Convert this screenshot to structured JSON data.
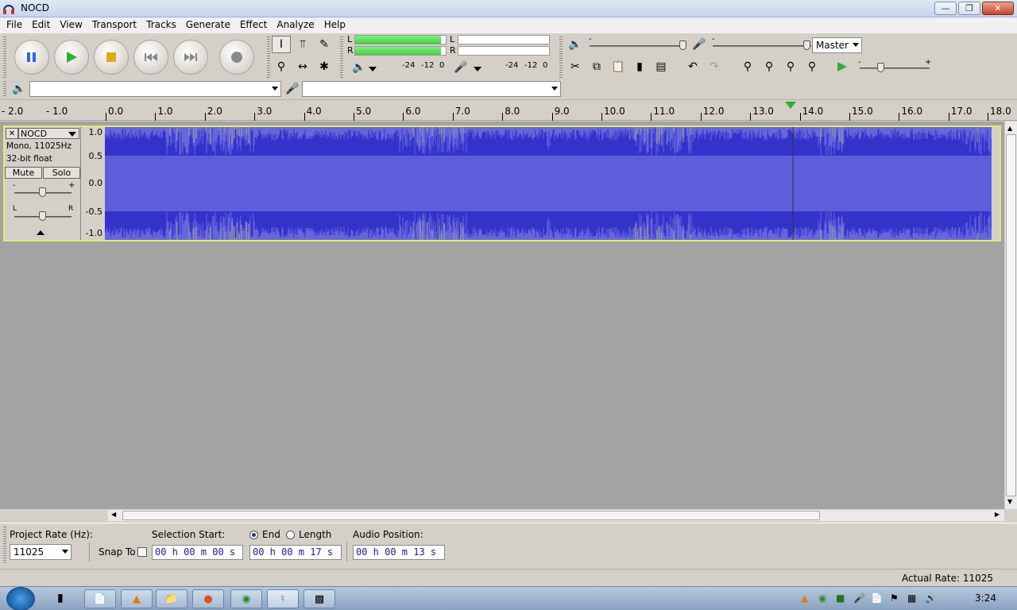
{
  "window": {
    "title": "NOCD"
  },
  "menu": [
    "File",
    "Edit",
    "View",
    "Transport",
    "Tracks",
    "Generate",
    "Effect",
    "Analyze",
    "Help"
  ],
  "meters": {
    "play_l": "L",
    "play_r": "R",
    "rec_l": "L",
    "rec_r": "R",
    "play_ticks": [
      "-24",
      "-12",
      "0"
    ],
    "rec_ticks": [
      "-24",
      "-12",
      "0"
    ],
    "play_level": 0.95
  },
  "mixer": {
    "output_select": "Master",
    "minus": "-",
    "plus": "+"
  },
  "device": {
    "output": "",
    "input": ""
  },
  "ruler": {
    "labels": [
      "- 2.0",
      "- 1.0",
      "0.0",
      "1.0",
      "2.0",
      "3.0",
      "4.0",
      "5.0",
      "6.0",
      "7.0",
      "8.0",
      "9.0",
      "10.0",
      "11.0",
      "12.0",
      "13.0",
      "14.0",
      "15.0",
      "16.0",
      "17.0",
      "18.0"
    ]
  },
  "track": {
    "name": "NOCD",
    "info1": "Mono, 11025Hz",
    "info2": "32-bit float",
    "mute": "Mute",
    "solo": "Solo",
    "gain_minus": "-",
    "gain_plus": "+",
    "pan_l": "L",
    "pan_r": "R",
    "vruler": [
      "1.0",
      "0.5",
      "0.0",
      "-0.5",
      "-1.0"
    ]
  },
  "selection": {
    "rate_label": "Project Rate (Hz):",
    "rate_value": "11025",
    "snap_label": "Snap To",
    "start_label": "Selection Start:",
    "end_label": "End",
    "length_label": "Length",
    "position_label": "Audio Position:",
    "start_value": "00 h 00 m 00 s",
    "end_value": "00 h 00 m 17 s",
    "position_value": "00 h 00 m 13 s"
  },
  "status": {
    "actual_rate": "Actual Rate: 11025"
  },
  "taskbar": {
    "clock": "3:24"
  },
  "colors": {
    "waveform": "#3333cc",
    "waveform_bg": "#6666dd",
    "track_border": "#e8e870",
    "meter": "#46d046"
  }
}
